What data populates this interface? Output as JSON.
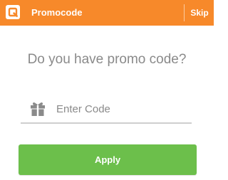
{
  "colors": {
    "brand": "#f7892a",
    "accent": "#6cbf4b",
    "heading_text": "#8a8a8a",
    "underline": "#cfcfcf"
  },
  "header": {
    "logo_icon": "q-logo-icon",
    "title": "Promocode",
    "skip_label": "Skip"
  },
  "main": {
    "heading": "Do you have promo code?",
    "code_field": {
      "icon": "gift-icon",
      "placeholder": "Enter Code",
      "value": ""
    },
    "apply_label": "Apply"
  }
}
